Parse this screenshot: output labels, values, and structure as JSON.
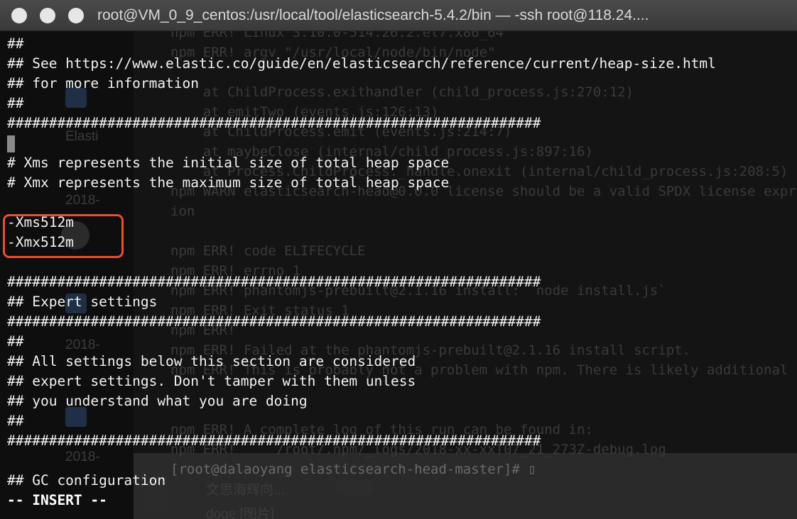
{
  "window": {
    "title": "root@VM_0_9_centos:/usr/local/tool/elasticsearch-5.4.2/bin — -ssh root@118.24...."
  },
  "editor": {
    "lines": [
      "##",
      "## See https://www.elastic.co/guide/en/elasticsearch/reference/current/heap-size.html",
      "## for more information",
      "##",
      "################################################################",
      "",
      "# Xms represents the initial size of total heap space",
      "# Xmx represents the maximum size of total heap space",
      "",
      "-Xms512m",
      "-Xmx512m",
      "",
      "################################################################",
      "## Expert settings",
      "################################################################",
      "##",
      "## All settings below this section are considered",
      "## expert settings. Don't tamper with them unless",
      "## you understand what you are doing",
      "##",
      "################################################################",
      "",
      "## GC configuration"
    ],
    "mode_line": "-- INSERT --",
    "highlight_color": "#e8502e"
  },
  "background_terminal": {
    "lines": [
      "npm ERR! Linux 3.10.0-514.26.2.el7.x86_64",
      "npm ERR! argv \"/usr/local/node/bin/node\"",
      "    at ChildProcess.exithandler (child_process.js:270:12)",
      "    at emitTwo (events.js:126:13)",
      "    at ChildProcess.emit (events.js:214:7)",
      "    at maybeClose (internal/child_process.js:897:16)",
      "    at Process.ChildProcess._handle.onexit (internal/child_process.js:208:5)",
      "npm WARN elasticsearch-head@0.0.0 license should be a valid SPDX license expressi",
      "ion",
      "",
      "npm ERR! code ELIFECYCLE",
      "npm ERR! errno 1",
      "npm ERR! phantomjs-prebuilt@2.1.16 install: `node install.js`",
      "npm ERR! Exit status 1",
      "npm ERR!",
      "npm ERR! Failed at the phantomjs-prebuilt@2.1.16 install script.",
      "npm ERR! This is probably not a problem with npm. There is likely additional",
      "",
      "npm ERR! A complete log of this run can be found in:",
      "npm ERR!     /root/.npm/_logs/2018-xx-xxT07_21_273Z-debug.log"
    ],
    "prompt": "[root@dalaoyang elasticsearch-head-master]# ▯"
  },
  "background_sidebar": {
    "items": [
      "Elasti",
      "2018-",
      "2018-",
      "2018-",
      "2018-"
    ],
    "chat_name": "文思海辉向...",
    "chat_preview": "doge:[图片]"
  }
}
